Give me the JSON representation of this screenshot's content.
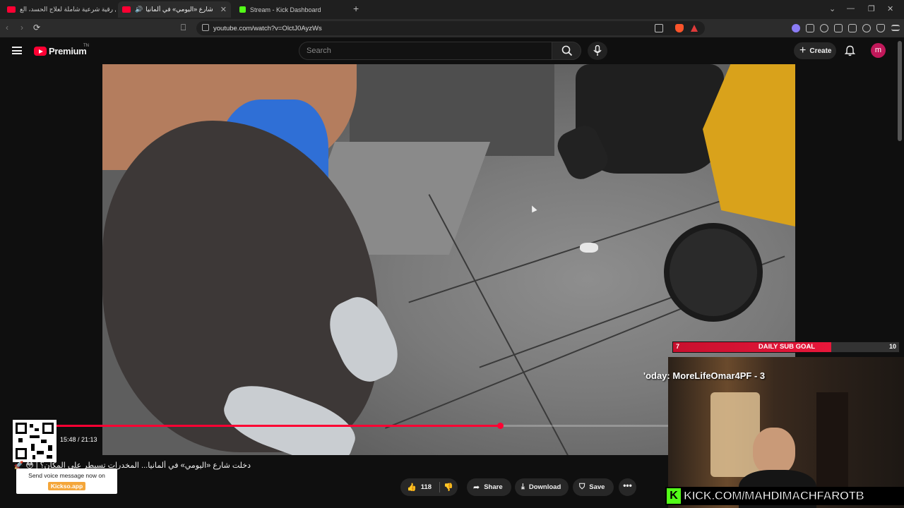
{
  "browser": {
    "tabs": [
      {
        "title": "أقوى رقية شرعية شاملة لعلاج الحسد، الع",
        "favicon_color": "#ff0033"
      },
      {
        "title": "دخلت شارع «اليومي» في ألمانيا",
        "favicon_color": "#ff0033"
      },
      {
        "title": "Stream - Kick Dashboard",
        "favicon_color": "#53fc18"
      }
    ],
    "close_glyph": "✕",
    "new_tab_glyph": "+",
    "url": "youtube.com/watch?v=OlctJ0AyzWs"
  },
  "youtube": {
    "logo_text": "Premium",
    "logo_sup": "TN",
    "search_placeholder": "Search",
    "create_label": "Create",
    "avatar_letter": "m",
    "brand_color": "#ff0033"
  },
  "player": {
    "time": "15:48 / 21:13",
    "progress": 0.744
  },
  "video": {
    "title": "دخلت شارع «اليومي» في ألمانيا... المخدرات تسيطر على المكان؟ | 😳 🚀",
    "likes": "118",
    "share_label": "Share",
    "download_label": "Download",
    "save_label": "Save",
    "more_glyph": "•••"
  },
  "overlay": {
    "voice_line1": "Send voice message now on",
    "voice_line2": "Kickso.app",
    "subgoal_current": "7",
    "subgoal_label": "DAILY SUB GOAL",
    "subgoal_target": "10",
    "subgoal_progress": 0.7,
    "ticker": "'oday: MoreLifeOmar4PF - 3",
    "kick_k": "K",
    "kick_url": "KICK.COM/MAHDIMACHFAROTB",
    "kick_color": "#53fc18"
  }
}
